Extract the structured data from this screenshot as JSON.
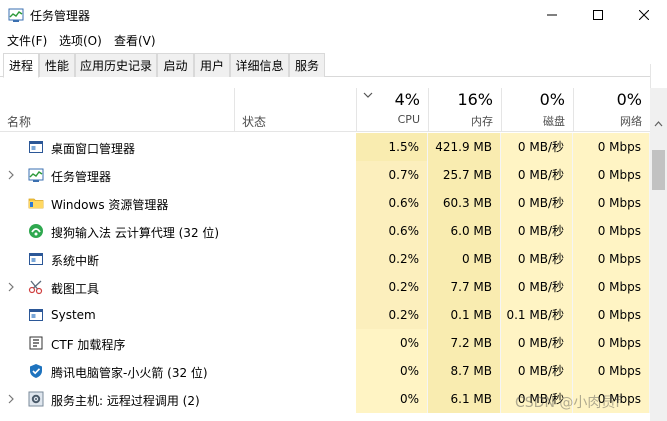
{
  "window": {
    "title": "任务管理器",
    "icon": "task-manager-icon"
  },
  "menu": {
    "items": [
      "文件(F)",
      "选项(O)",
      "查看(V)"
    ]
  },
  "tabs": [
    "进程",
    "性能",
    "应用历史记录",
    "启动",
    "用户",
    "详细信息",
    "服务"
  ],
  "header": {
    "name": "名称",
    "status": "状态",
    "cpu": {
      "pct": "4%",
      "label": "CPU"
    },
    "mem": {
      "pct": "16%",
      "label": "内存"
    },
    "disk": {
      "pct": "0%",
      "label": "磁盘"
    },
    "net": {
      "pct": "0%",
      "label": "网络"
    }
  },
  "processes": [
    {
      "name": "桌面窗口管理器",
      "icon": "window-icon",
      "expandable": false,
      "cpu": "1.5%",
      "mem": "421.9 MB",
      "disk": "0 MB/秒",
      "net": "0 Mbps"
    },
    {
      "name": "任务管理器",
      "icon": "task-manager-icon",
      "expandable": true,
      "cpu": "0.7%",
      "mem": "25.7 MB",
      "disk": "0 MB/秒",
      "net": "0 Mbps"
    },
    {
      "name": "Windows 资源管理器",
      "icon": "folder-icon",
      "expandable": false,
      "cpu": "0.6%",
      "mem": "60.3 MB",
      "disk": "0 MB/秒",
      "net": "0 Mbps"
    },
    {
      "name": "搜狗输入法 云计算代理 (32 位)",
      "icon": "sogou-icon",
      "expandable": false,
      "cpu": "0.6%",
      "mem": "6.0 MB",
      "disk": "0 MB/秒",
      "net": "0 Mbps"
    },
    {
      "name": "系统中断",
      "icon": "window-icon",
      "expandable": false,
      "cpu": "0.2%",
      "mem": "0 MB",
      "disk": "0 MB/秒",
      "net": "0 Mbps"
    },
    {
      "name": "截图工具",
      "icon": "scissors-icon",
      "expandable": true,
      "cpu": "0.2%",
      "mem": "7.7 MB",
      "disk": "0 MB/秒",
      "net": "0 Mbps"
    },
    {
      "name": "System",
      "icon": "window-icon",
      "expandable": false,
      "cpu": "0.2%",
      "mem": "0.1 MB",
      "disk": "0.1 MB/秒",
      "net": "0 Mbps"
    },
    {
      "name": "CTF 加载程序",
      "icon": "ctf-icon",
      "expandable": false,
      "cpu": "0%",
      "mem": "7.2 MB",
      "disk": "0 MB/秒",
      "net": "0 Mbps"
    },
    {
      "name": "腾讯电脑管家-小火箭 (32 位)",
      "icon": "shield-icon",
      "expandable": false,
      "cpu": "0%",
      "mem": "8.7 MB",
      "disk": "0 MB/秒",
      "net": "0 Mbps"
    },
    {
      "name": "服务主机: 远程过程调用 (2)",
      "icon": "gear-icon",
      "expandable": true,
      "cpu": "0%",
      "mem": "6.1 MB",
      "disk": "0 MB/秒",
      "net": "0 Mbps"
    }
  ],
  "watermark": "CSDN @小肉员f",
  "colors": {
    "heat_high": "#f9ecb0",
    "heat_mid": "#fcefbd",
    "heat_low": "#fff4c4",
    "tab_border": "#d9d9d9",
    "accent": "#1e73be"
  }
}
